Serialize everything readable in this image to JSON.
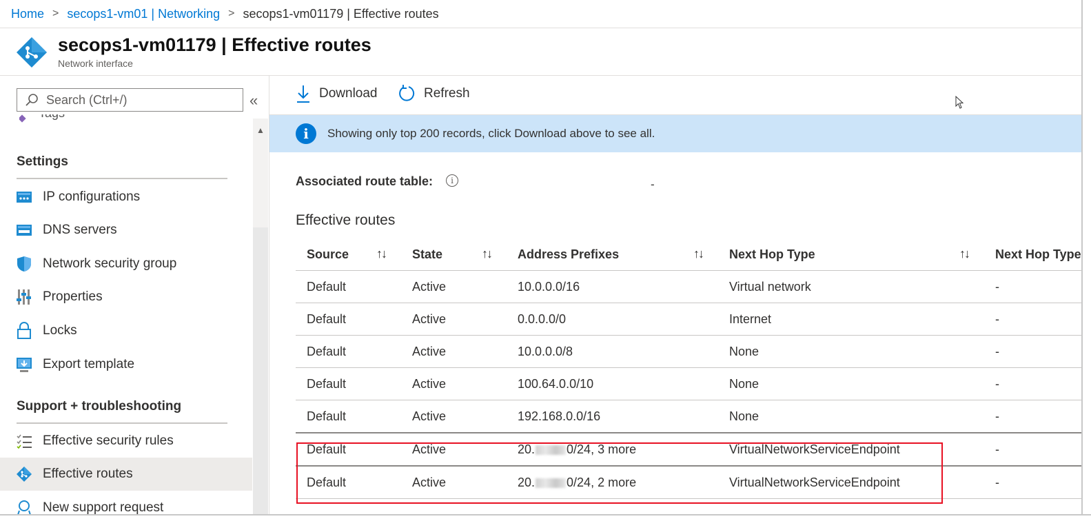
{
  "breadcrumb": {
    "home": "Home",
    "parent": "secops1-vm01 | Networking",
    "current": "secops1-vm01179 | Effective routes"
  },
  "header": {
    "title": "secops1-vm01179 | Effective routes",
    "subtitle": "Network interface",
    "icon": "network-interface-icon"
  },
  "sidebar": {
    "search_placeholder": "Search (Ctrl+/)",
    "collapse_glyph": "«",
    "partial_item": "Tags",
    "settings_title": "Settings",
    "settings_items": [
      {
        "label": "IP configurations",
        "icon": "ip-configurations-icon"
      },
      {
        "label": "DNS servers",
        "icon": "dns-servers-icon"
      },
      {
        "label": "Network security group",
        "icon": "shield-icon"
      },
      {
        "label": "Properties",
        "icon": "properties-icon"
      },
      {
        "label": "Locks",
        "icon": "lock-icon"
      },
      {
        "label": "Export template",
        "icon": "export-template-icon"
      }
    ],
    "support_title": "Support + troubleshooting",
    "support_items": [
      {
        "label": "Effective security rules",
        "icon": "security-rules-icon"
      },
      {
        "label": "Effective routes",
        "icon": "effective-routes-icon",
        "active": true
      },
      {
        "label": "New support request",
        "icon": "support-request-icon"
      }
    ]
  },
  "toolbar": {
    "download_label": "Download",
    "refresh_label": "Refresh"
  },
  "banner": {
    "message": "Showing only top 200 records, click Download above to see all."
  },
  "associated_route_table": {
    "label": "Associated route table:",
    "value": "-"
  },
  "routes": {
    "title": "Effective routes",
    "sort_glyph": "↑↓",
    "columns": [
      "Source",
      "State",
      "Address Prefixes",
      "Next Hop Type",
      "Next Hop Type"
    ],
    "rows": [
      {
        "source": "Default",
        "state": "Active",
        "prefix": "10.0.0.0/16",
        "next_hop_type": "Virtual network",
        "next_hop_ip": "-"
      },
      {
        "source": "Default",
        "state": "Active",
        "prefix": "0.0.0.0/0",
        "next_hop_type": "Internet",
        "next_hop_ip": "-"
      },
      {
        "source": "Default",
        "state": "Active",
        "prefix": "10.0.0.0/8",
        "next_hop_type": "None",
        "next_hop_ip": "-"
      },
      {
        "source": "Default",
        "state": "Active",
        "prefix": "100.64.0.0/10",
        "next_hop_type": "None",
        "next_hop_ip": "-"
      },
      {
        "source": "Default",
        "state": "Active",
        "prefix": "192.168.0.0/16",
        "next_hop_type": "None",
        "next_hop_ip": "-"
      },
      {
        "source": "Default",
        "state": "Active",
        "prefix_start": "20.",
        "prefix_end": "0/24, 3 more",
        "next_hop_type": "VirtualNetworkServiceEndpoint",
        "next_hop_ip": "-"
      },
      {
        "source": "Default",
        "state": "Active",
        "prefix_start": "20.",
        "prefix_end": "0/24, 2 more",
        "next_hop_type": "VirtualNetworkServiceEndpoint",
        "next_hop_ip": "-"
      }
    ]
  },
  "colors": {
    "accent": "#0078d4",
    "banner_bg": "#cce4f9",
    "highlight": "#e81123"
  }
}
